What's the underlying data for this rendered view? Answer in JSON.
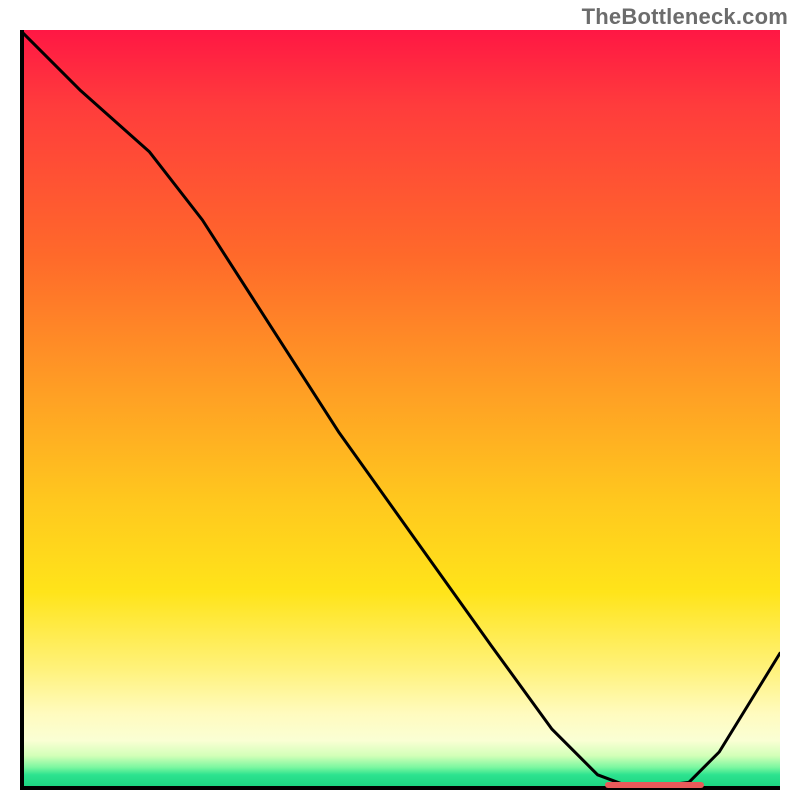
{
  "attribution": "TheBottleneck.com",
  "colors": {
    "top": "#ff1744",
    "bottom": "#17cf7d",
    "marker": "#e85a5a",
    "curve": "#000000"
  },
  "chart_data": {
    "type": "line",
    "title": "",
    "xlabel": "",
    "ylabel": "",
    "xlim": [
      0,
      100
    ],
    "ylim": [
      0,
      100
    ],
    "grid": false,
    "legend": false,
    "annotations": [],
    "x": [
      0,
      8,
      17,
      24,
      33,
      42,
      52,
      62,
      70,
      76,
      80,
      84,
      88,
      92,
      100
    ],
    "values": [
      100,
      92,
      84,
      75,
      61,
      47,
      33,
      19,
      8,
      2,
      0.5,
      0.5,
      1,
      5,
      18
    ],
    "optimal_range": {
      "x_start": 77,
      "x_end": 90,
      "y": 0.5
    }
  }
}
